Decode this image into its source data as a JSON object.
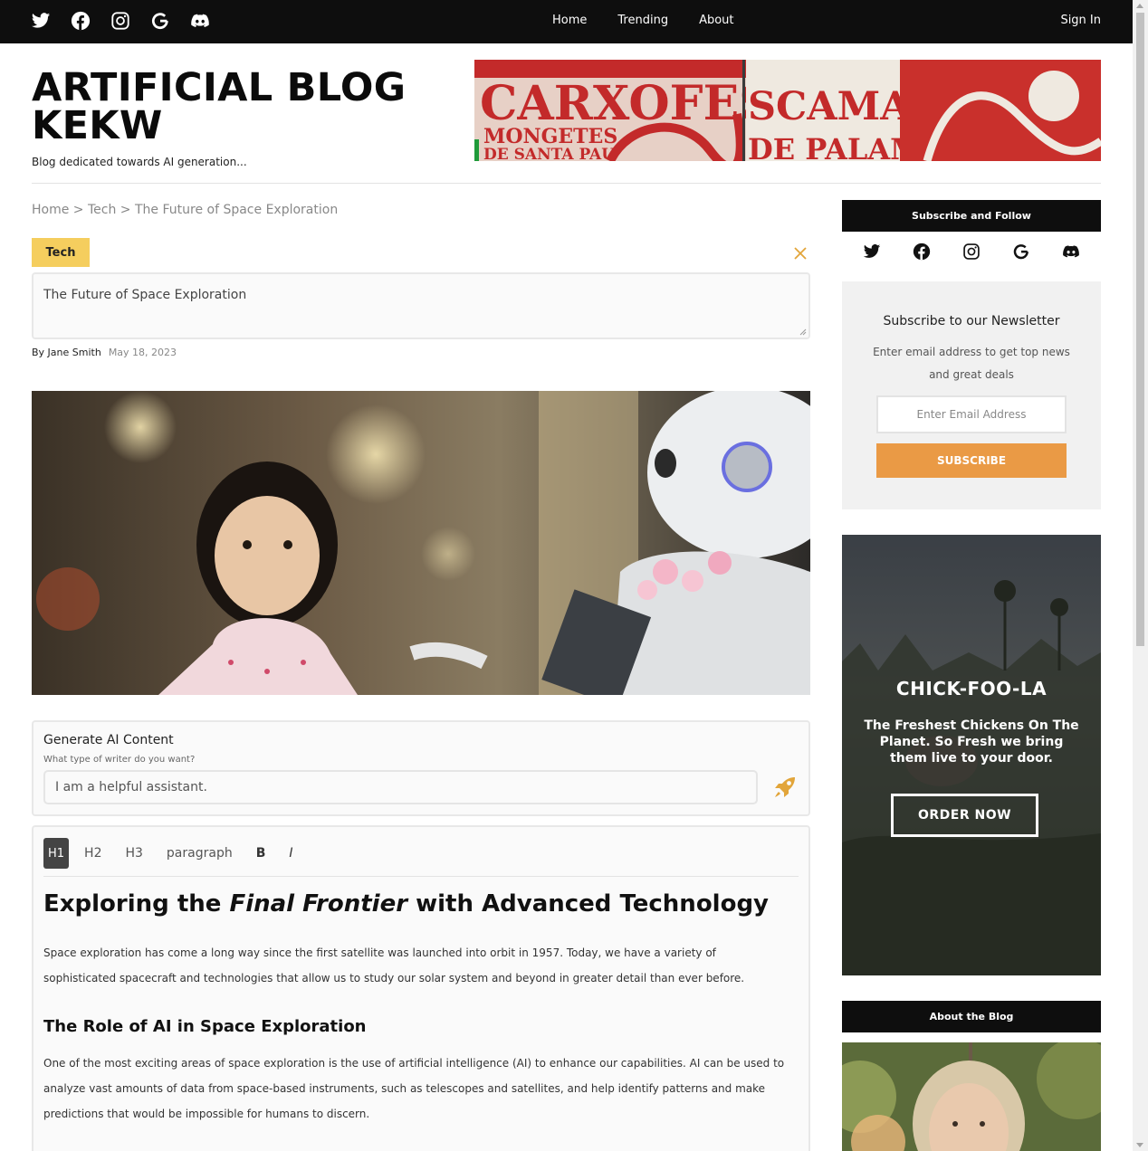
{
  "nav": {
    "social_icons": [
      "twitter-icon",
      "facebook-icon",
      "instagram-icon",
      "google-icon",
      "discord-icon"
    ],
    "links": [
      "Home",
      "Trending",
      "About"
    ],
    "sign_in": "Sign In"
  },
  "header": {
    "title": "ARTIFICIAL BLOG KEKW",
    "tagline": "Blog dedicated towards AI generation...",
    "banner_text": [
      "CARXOFES",
      "SCAMARLANS",
      "MONGETES",
      "DE SANTA PAU",
      "DE PALAMOS"
    ]
  },
  "breadcrumb": {
    "home": "Home",
    "sep": ">",
    "category": "Tech",
    "current": "The Future of Space Exploration"
  },
  "post": {
    "category": "Tech",
    "title_value": "The Future of Space Exploration",
    "author": "By Jane Smith",
    "date": "May 18, 2023"
  },
  "generate": {
    "title": "Generate AI Content",
    "subtitle": "What type of writer do you want?",
    "input_value": "I am a helpful assistant."
  },
  "editor": {
    "toolbar": [
      "H1",
      "H2",
      "H3",
      "paragraph",
      "B",
      "I"
    ],
    "h1_pre": "Exploring the ",
    "h1_em": "Final Frontier",
    "h1_post": " with Advanced Technology",
    "p1": "Space exploration has come a long way since the first satellite was launched into orbit in 1957. Today, we have a variety of sophisticated spacecraft and technologies that allow us to study our solar system and beyond in greater detail than ever before.",
    "h2": "The Role of AI in Space Exploration",
    "p2": "One of the most exciting areas of space exploration is the use of artificial intelligence (AI) to enhance our capabilities. AI can be used to analyze vast amounts of data from space-based instruments, such as telescopes and satellites, and help identify patterns and make predictions that would be impossible for humans to discern."
  },
  "sidebar": {
    "follow_heading": "Subscribe and Follow",
    "newsletter": {
      "title": "Subscribe to our Newsletter",
      "text": "Enter email address to get top news and great deals",
      "placeholder": "Enter Email Address",
      "button": "SUBSCRIBE"
    },
    "ad": {
      "title": "CHICK-FOO-LA",
      "text": "The Freshest Chickens On The Planet. So Fresh we bring them live to your door.",
      "button": "ORDER NOW"
    },
    "about_heading": "About the Blog"
  },
  "colors": {
    "topbar": "#0e0e0e",
    "badge": "#f5ce5e",
    "subscribe_button": "#ea9a45",
    "accent_icon": "#e2a53a"
  }
}
